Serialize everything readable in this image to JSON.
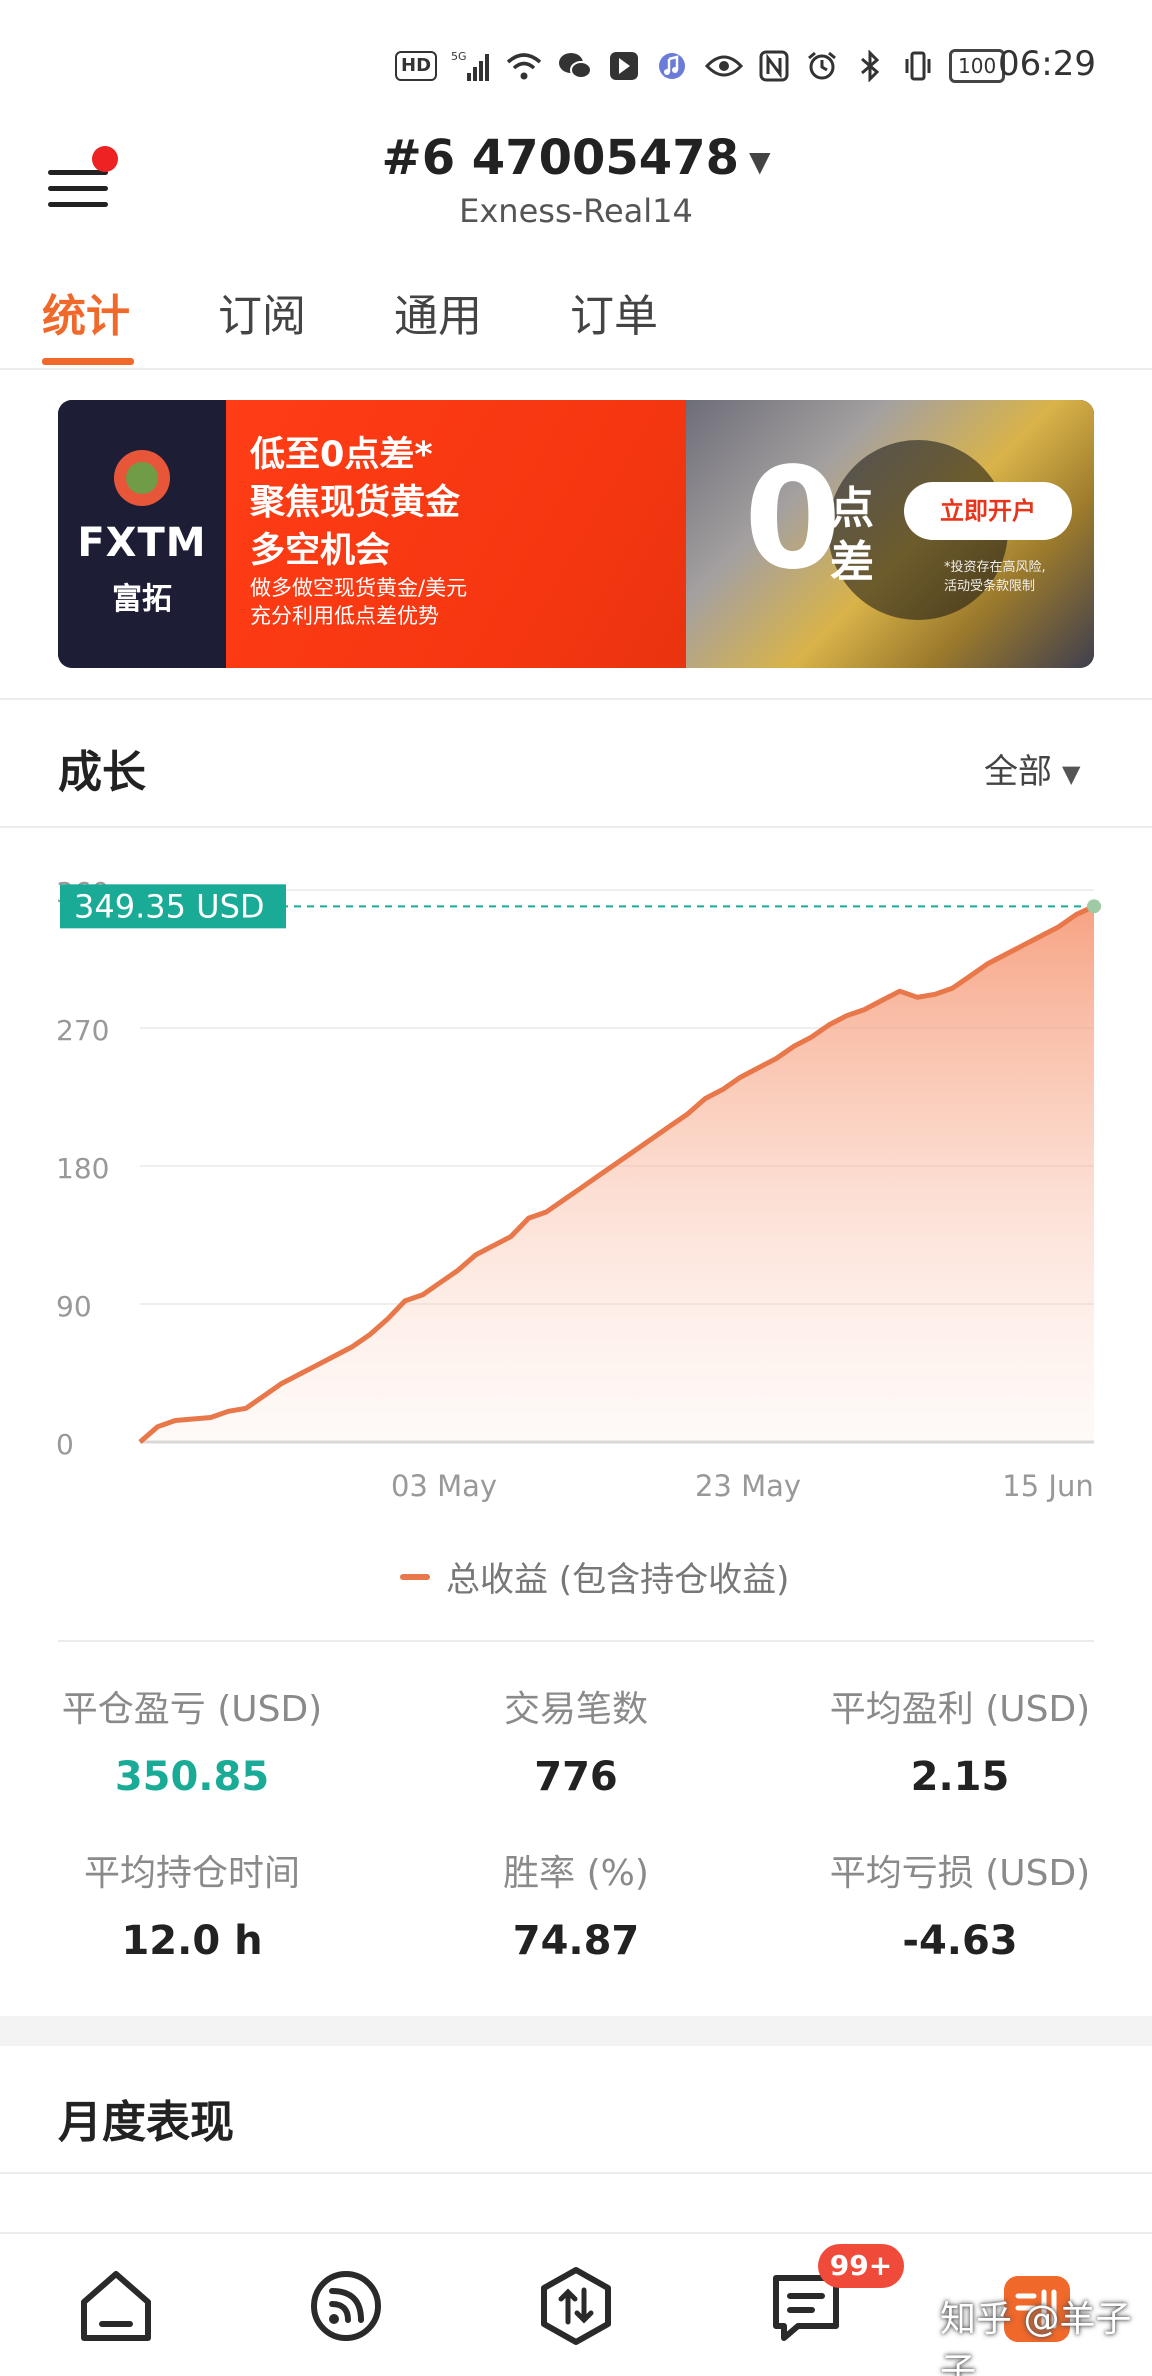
{
  "status_bar": {
    "hd": "HD",
    "network": "5G",
    "battery": "100",
    "time": "06:29"
  },
  "header": {
    "account_id": "#6  47005478",
    "server": "Exness-Real14"
  },
  "tabs": [
    {
      "label": "统计",
      "active": true
    },
    {
      "label": "订阅",
      "active": false
    },
    {
      "label": "通用",
      "active": false
    },
    {
      "label": "订单",
      "active": false
    }
  ],
  "banner": {
    "brand": "FXTM",
    "brand_cn": "富拓",
    "headline_1": "低至0点差*",
    "headline_2": "聚焦现货黄金",
    "headline_3": "多空机会",
    "sub_1": "做多做空现货黄金/美元",
    "sub_2": "充分利用低点差优势",
    "zero_digit": "0",
    "zero_char_1": "点",
    "zero_char_2": "差",
    "cta": "立即开户",
    "note_1": "*投资存在高风险,",
    "note_2": "活动受条款限制"
  },
  "growth": {
    "title": "成长",
    "filter": "全部"
  },
  "chart_data": {
    "type": "area",
    "ylim": [
      0,
      360
    ],
    "yticks": [
      0,
      90,
      180,
      270,
      360
    ],
    "ytick_labels": [
      "0",
      "90",
      "180",
      "270",
      "360"
    ],
    "xtick_labels": [
      "03 May",
      "23 May",
      "15 Jun"
    ],
    "series": [
      {
        "name": "总收益 (包含持仓收益)",
        "color": "#e8774a",
        "values": [
          0,
          10,
          14,
          15,
          16,
          20,
          22,
          30,
          38,
          44,
          50,
          56,
          62,
          70,
          80,
          92,
          96,
          104,
          112,
          122,
          128,
          134,
          146,
          150,
          158,
          166,
          174,
          182,
          190,
          198,
          206,
          214,
          224,
          230,
          238,
          244,
          250,
          258,
          264,
          272,
          278,
          282,
          288,
          294,
          290,
          292,
          296,
          304,
          312,
          318,
          324,
          330,
          336,
          344,
          349.35
        ]
      }
    ],
    "current_value_label": "349.35 USD",
    "legend": "总收益 (包含持仓收益)"
  },
  "stats": {
    "closed_pl_label": "平仓盈亏 (USD)",
    "closed_pl_value": "350.85",
    "trades_label": "交易笔数",
    "trades_value": "776",
    "avg_profit_label": "平均盈利 (USD)",
    "avg_profit_value": "2.15",
    "avg_hold_label": "平均持仓时间",
    "avg_hold_value": "12.0 h",
    "win_rate_label": "胜率 (%)",
    "win_rate_value": "74.87",
    "avg_loss_label": "平均亏损 (USD)",
    "avg_loss_value": "-4.63"
  },
  "monthly": {
    "title": "月度表现"
  },
  "bottom_nav": {
    "badge": "99+",
    "watermark": "知乎 @羊子子",
    "icons": [
      "home-icon",
      "signal-feed-icon",
      "trade-icon",
      "message-icon",
      "profile-icon"
    ]
  },
  "colors": {
    "accent": "#f0682a",
    "positive": "#1aab96",
    "badge": "#ef4a3a"
  }
}
